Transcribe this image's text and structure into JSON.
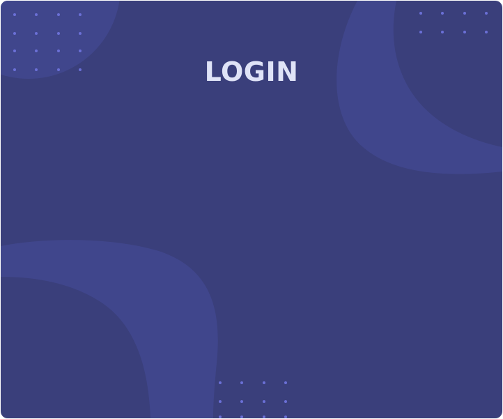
{
  "login_card": {
    "title": "LOGIN"
  },
  "colors": {
    "card_background": "#3a3f7b",
    "blob_fill": "#40468c",
    "dot_color": "#6b70d6",
    "title_color": "#dfe3f7"
  }
}
